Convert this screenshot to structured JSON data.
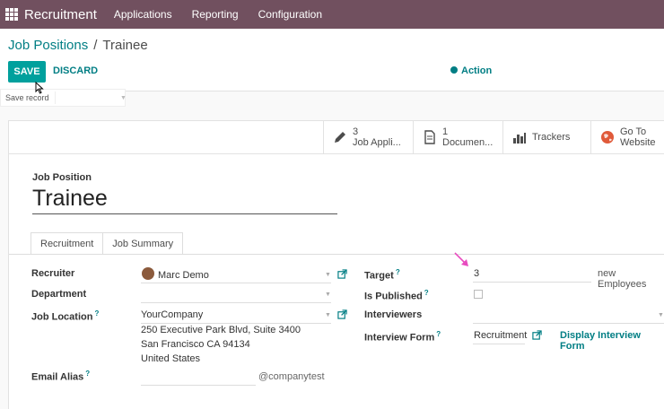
{
  "navbar": {
    "app_name": "Recruitment",
    "menu": [
      "Applications",
      "Reporting",
      "Configuration"
    ]
  },
  "breadcrumb": {
    "parent": "Job Positions",
    "separator": "/",
    "current": "Trainee"
  },
  "toolbar": {
    "save_label": "SAVE",
    "discard_label": "DISCARD",
    "action_label": "Action",
    "tooltip": "Save record"
  },
  "smart_buttons": [
    {
      "icon": "pencil-icon",
      "line1": "3",
      "line2": "Job Appli..."
    },
    {
      "icon": "document-icon",
      "line1": "1",
      "line2": "Documen..."
    },
    {
      "icon": "bar-chart-icon",
      "line1": "Trackers",
      "line2": ""
    },
    {
      "icon": "globe-icon",
      "line1": "Go To",
      "line2": "Website"
    }
  ],
  "form": {
    "job_position_label": "Job Position",
    "job_position_value": "Trainee",
    "tabs": [
      "Recruitment",
      "Job Summary"
    ],
    "active_tab": "Recruitment",
    "recruiter_label": "Recruiter",
    "recruiter_value": "Marc Demo",
    "department_label": "Department",
    "department_value": "",
    "job_location_label": "Job Location",
    "job_location_value": "YourCompany",
    "address_line1": "250 Executive Park Blvd, Suite 3400",
    "address_line2": "San Francisco CA 94134",
    "address_line3": "United States",
    "email_alias_label": "Email Alias",
    "email_alias_value": "",
    "email_domain": "@companytest",
    "target_label": "Target",
    "target_value": "3",
    "target_unit": "new Employees",
    "is_published_label": "Is Published",
    "is_published": false,
    "interviewers_label": "Interviewers",
    "interviewers_value": "",
    "interview_form_label": "Interview Form",
    "interview_form_value": "Recruitment",
    "display_interview_form_label": "Display Interview Form",
    "help_marker": "?"
  },
  "colors": {
    "navbar": "#71505f",
    "primary": "#00a09d",
    "link": "#017e84",
    "arrow": "#e84bbf"
  }
}
